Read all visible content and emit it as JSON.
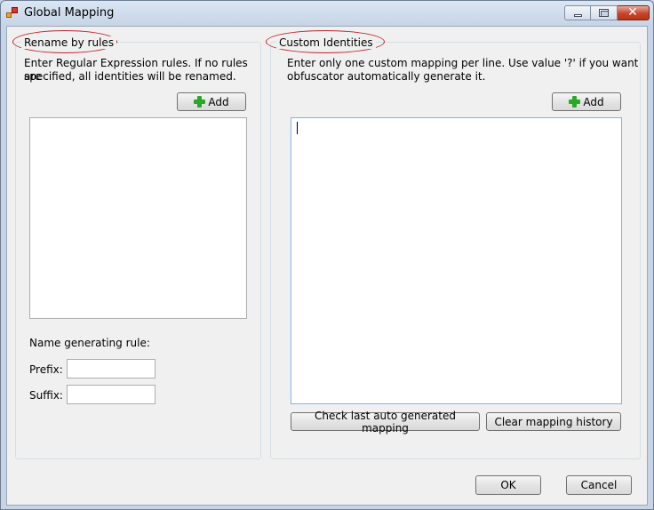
{
  "window": {
    "title": "Global Mapping"
  },
  "rename_rules": {
    "legend": "Rename by rules",
    "description_line1": "Enter Regular Expression rules. If no rules are",
    "description_line2": "specified, all identities will be renamed.",
    "add_label": "Add",
    "name_rule_label": "Name generating rule:",
    "prefix_label": "Prefix:",
    "prefix_value": "",
    "suffix_label": "Suffix:",
    "suffix_value": ""
  },
  "custom_identities": {
    "legend": "Custom Identities",
    "description_line1": "Enter only one custom mapping per line. Use value '?' if you want",
    "description_line2": "obfuscator automatically generate it.",
    "add_label": "Add",
    "mapping_text": "",
    "check_label": "Check last auto generated mapping",
    "clear_label": "Clear mapping history"
  },
  "footer": {
    "ok_label": "OK",
    "cancel_label": "Cancel"
  },
  "colors": {
    "annotation_ellipse": "#c0222a",
    "plus_icon": "#2aa82a",
    "close_button": "#c4462c"
  }
}
